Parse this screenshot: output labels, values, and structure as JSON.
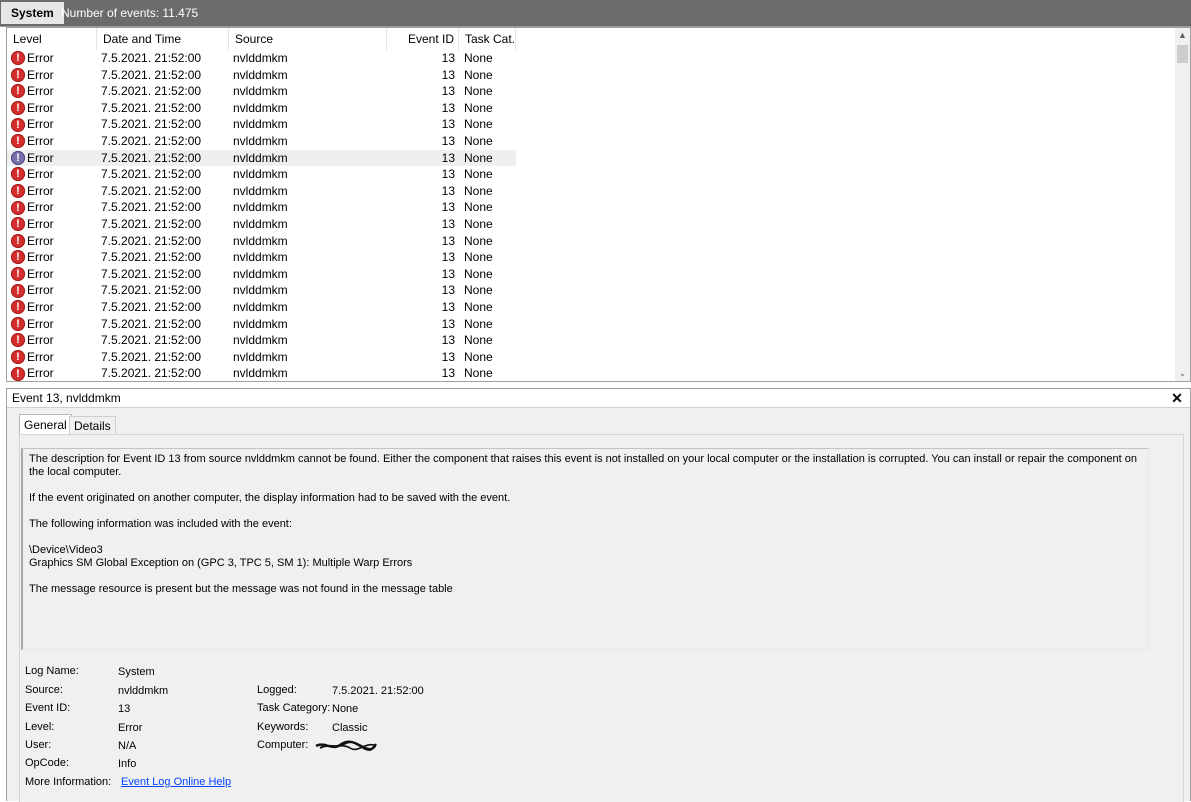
{
  "titlebar": {
    "name": "System",
    "count": "Number of events: 11.475"
  },
  "table": {
    "headers": {
      "level": "Level",
      "date": "Date and Time",
      "source": "Source",
      "event_id": "Event ID",
      "task": "Task Cat..."
    },
    "rows": [
      {
        "level": "Error",
        "date": "7.5.2021. 21:52:00",
        "source": "nvlddmkm",
        "event_id": "13",
        "task": "None"
      },
      {
        "level": "Error",
        "date": "7.5.2021. 21:52:00",
        "source": "nvlddmkm",
        "event_id": "13",
        "task": "None"
      },
      {
        "level": "Error",
        "date": "7.5.2021. 21:52:00",
        "source": "nvlddmkm",
        "event_id": "13",
        "task": "None"
      },
      {
        "level": "Error",
        "date": "7.5.2021. 21:52:00",
        "source": "nvlddmkm",
        "event_id": "13",
        "task": "None"
      },
      {
        "level": "Error",
        "date": "7.5.2021. 21:52:00",
        "source": "nvlddmkm",
        "event_id": "13",
        "task": "None"
      },
      {
        "level": "Error",
        "date": "7.5.2021. 21:52:00",
        "source": "nvlddmkm",
        "event_id": "13",
        "task": "None"
      },
      {
        "level": "Error",
        "date": "7.5.2021. 21:52:00",
        "source": "nvlddmkm",
        "event_id": "13",
        "task": "None"
      },
      {
        "level": "Error",
        "date": "7.5.2021. 21:52:00",
        "source": "nvlddmkm",
        "event_id": "13",
        "task": "None"
      },
      {
        "level": "Error",
        "date": "7.5.2021. 21:52:00",
        "source": "nvlddmkm",
        "event_id": "13",
        "task": "None"
      },
      {
        "level": "Error",
        "date": "7.5.2021. 21:52:00",
        "source": "nvlddmkm",
        "event_id": "13",
        "task": "None"
      },
      {
        "level": "Error",
        "date": "7.5.2021. 21:52:00",
        "source": "nvlddmkm",
        "event_id": "13",
        "task": "None"
      },
      {
        "level": "Error",
        "date": "7.5.2021. 21:52:00",
        "source": "nvlddmkm",
        "event_id": "13",
        "task": "None"
      },
      {
        "level": "Error",
        "date": "7.5.2021. 21:52:00",
        "source": "nvlddmkm",
        "event_id": "13",
        "task": "None"
      },
      {
        "level": "Error",
        "date": "7.5.2021. 21:52:00",
        "source": "nvlddmkm",
        "event_id": "13",
        "task": "None"
      },
      {
        "level": "Error",
        "date": "7.5.2021. 21:52:00",
        "source": "nvlddmkm",
        "event_id": "13",
        "task": "None"
      },
      {
        "level": "Error",
        "date": "7.5.2021. 21:52:00",
        "source": "nvlddmkm",
        "event_id": "13",
        "task": "None"
      },
      {
        "level": "Error",
        "date": "7.5.2021. 21:52:00",
        "source": "nvlddmkm",
        "event_id": "13",
        "task": "None"
      },
      {
        "level": "Error",
        "date": "7.5.2021. 21:52:00",
        "source": "nvlddmkm",
        "event_id": "13",
        "task": "None"
      },
      {
        "level": "Error",
        "date": "7.5.2021. 21:52:00",
        "source": "nvlddmkm",
        "event_id": "13",
        "task": "None"
      },
      {
        "level": "Error",
        "date": "7.5.2021. 21:52:00",
        "source": "nvlddmkm",
        "event_id": "13",
        "task": "None"
      }
    ],
    "selected_row": 6,
    "level_icon": "error-icon",
    "icon_colors": {
      "error": "#d42d2d",
      "selected": "#7a6fa8"
    }
  },
  "detail": {
    "title": "Event 13, nvlddmkm",
    "close_icon": "close-icon",
    "tabs": [
      "General",
      "Details"
    ],
    "active_tab": 0,
    "description": [
      "The description for Event ID 13 from source nvlddmkm cannot be found. Either the component that raises this event is not installed on your local computer or the installation is corrupted. You can install or repair the component on the local computer.",
      "",
      "If the event originated on another computer, the display information had to be saved with the event.",
      "",
      "The following information was included with the event:",
      "",
      "\\Device\\Video3",
      "Graphics SM Global Exception on (GPC 3, TPC 5, SM 1): Multiple Warp Errors",
      "",
      "The message resource is present but the message was not found in the message table"
    ],
    "fields": {
      "log_name_label": "Log Name:",
      "log_name": "System",
      "source_label": "Source:",
      "source": "nvlddmkm",
      "event_id_label": "Event ID:",
      "event_id": "13",
      "level_label": "Level:",
      "level": "Error",
      "user_label": "User:",
      "user": "N/A",
      "opcode_label": "OpCode:",
      "opcode": "Info",
      "more_info_label": "More Information:",
      "more_info_link": "Event Log Online Help",
      "logged_label": "Logged:",
      "logged": "7.5.2021. 21:52:00",
      "task_category_label": "Task Category:",
      "task_category": "None",
      "keywords_label": "Keywords:",
      "keywords": "Classic",
      "computer_label": "Computer:"
    }
  }
}
